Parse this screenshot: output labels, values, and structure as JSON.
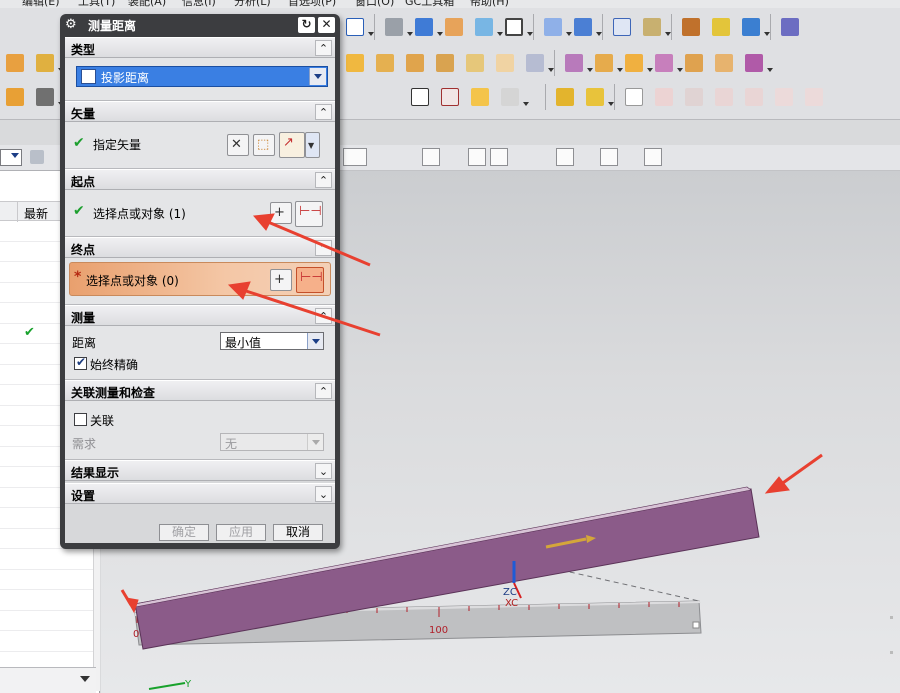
{
  "menubar": [
    "编辑(E)",
    "工具(T)",
    "装配(A)",
    "信息(I)",
    "分析(L)",
    "首选项(P)",
    "窗口(O)",
    "GC工具箱",
    "帮助(H)"
  ],
  "navigator": {
    "column_latest": "最新"
  },
  "dialog": {
    "title": "测量距离",
    "sections": {
      "type": {
        "label": "类型",
        "value": "投影距离"
      },
      "vector": {
        "label": "矢量",
        "row_label": "指定矢量"
      },
      "start": {
        "label": "起点",
        "row_label": "选择点或对象 (1)"
      },
      "end": {
        "label": "终点",
        "row_label": "选择点或对象 (0)"
      },
      "measure": {
        "label": "测量",
        "distance_label": "距离",
        "distance_value": "最小值",
        "always_exact": "始终精确"
      },
      "assoc": {
        "label": "关联测量和检查",
        "associate": "关联",
        "requirement": "需求",
        "requirement_value": "无"
      },
      "results": {
        "label": "结果显示"
      },
      "settings": {
        "label": "设置"
      }
    },
    "buttons": {
      "ok": "确定",
      "apply": "应用",
      "cancel": "取消"
    }
  },
  "viewport": {
    "axis_zc": "ZC",
    "axis_xc": "XC",
    "axis_y": "Y",
    "ruler_label_0": "0",
    "ruler_label_100": "100"
  },
  "colors": {
    "part": "#8c5a8a",
    "arrow": "#e84030",
    "selected_combo": "#3a7fe3",
    "active_row": "#f0b88e"
  }
}
